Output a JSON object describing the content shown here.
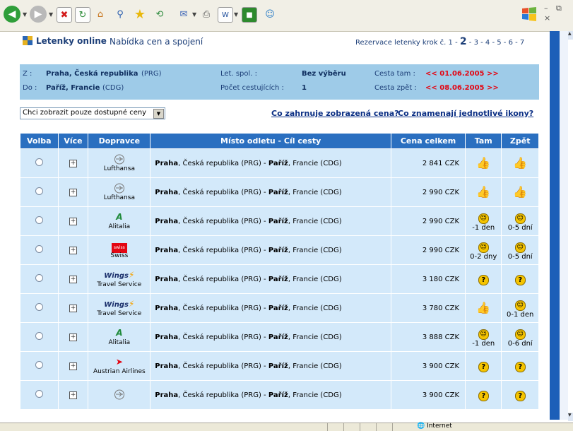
{
  "toolbar": {
    "buttons": [
      "back-icon",
      "forward-icon",
      "stop-icon",
      "refresh-icon",
      "home-icon",
      "search-icon",
      "favorites-icon",
      "history-icon",
      "mail-icon",
      "print-icon",
      "edit-icon",
      "messenger-icon",
      "contacts-icon"
    ],
    "window_controls": "– ⧉ ×"
  },
  "header": {
    "brand": "Letenky online",
    "subtitle": "Nabídka cen a spojení",
    "steps_prefix": "Rezervace letenky krok č. 1 - ",
    "current_step": "2",
    "steps_suffix": " - 3 - 4 - 5 - 6 - 7"
  },
  "info": {
    "from_label": "Z :",
    "from_value": "Praha, Česká republika",
    "from_code": "(PRG)",
    "to_label": "Do :",
    "to_value": "Paříž, Francie",
    "to_code": "(CDG)",
    "airline_label": "Let. spol. :",
    "airline_value": "Bez výběru",
    "passengers_label": "Počet cestujících :",
    "passengers_value": "1",
    "out_label": "Cesta tam :",
    "out_value": "<< 01.06.2005 >>",
    "back_label": "Cesta zpět :",
    "back_value": "<< 08.06.2005 >>"
  },
  "filter": {
    "select_value": "Chci zobrazit pouze dostupné ceny",
    "link_price": "Co zahrnuje zobrazená cena?",
    "link_icons": "Co znamenají jednotlivé ikony?"
  },
  "table": {
    "headers": [
      "Volba",
      "Více",
      "Dopravce",
      "Místo odletu - Cíl cesty",
      "Cena celkem",
      "Tam",
      "Zpět"
    ],
    "route_from": "Praha",
    "route_from_rest": ", Česká republika (PRG) - ",
    "route_to": "Paříž",
    "route_to_rest": ", Francie (CDG)",
    "rows": [
      {
        "carrier": "Lufthansa",
        "logo": "lufthansa-logo",
        "price": "2 841 CZK",
        "tam": "thumb",
        "tam_sub": "",
        "zpet": "thumb",
        "zpet_sub": ""
      },
      {
        "carrier": "Lufthansa",
        "logo": "lufthansa-logo",
        "price": "2 990 CZK",
        "tam": "thumb",
        "tam_sub": "",
        "zpet": "thumb",
        "zpet_sub": ""
      },
      {
        "carrier": "Alitalia",
        "logo": "alitalia-logo",
        "price": "2 990 CZK",
        "tam": "smile",
        "tam_sub": "-1 den",
        "zpet": "smile",
        "zpet_sub": "0-5 dní"
      },
      {
        "carrier": "Swiss",
        "logo": "swiss-logo",
        "price": "2 990 CZK",
        "tam": "smile",
        "tam_sub": "0-2 dny",
        "zpet": "smile",
        "zpet_sub": "0-5 dní"
      },
      {
        "carrier": "Travel Service",
        "logo": "smartwings-logo",
        "price": "3 180 CZK",
        "tam": "question",
        "tam_sub": "",
        "zpet": "question",
        "zpet_sub": ""
      },
      {
        "carrier": "Travel Service",
        "logo": "smartwings-logo",
        "price": "3 780 CZK",
        "tam": "thumb",
        "tam_sub": "",
        "zpet": "smile",
        "zpet_sub": "0-1 den"
      },
      {
        "carrier": "Alitalia",
        "logo": "alitalia-logo",
        "price": "3 888 CZK",
        "tam": "smile",
        "tam_sub": "-1 den",
        "zpet": "smile",
        "zpet_sub": "0-6 dní"
      },
      {
        "carrier": "Austrian Airlines",
        "logo": "austrian-logo",
        "price": "3 900 CZK",
        "tam": "question",
        "tam_sub": "",
        "zpet": "question",
        "zpet_sub": ""
      },
      {
        "carrier": "",
        "logo": "lufthansa-logo",
        "price": "3 900 CZK",
        "tam": "question",
        "tam_sub": "",
        "zpet": "question",
        "zpet_sub": ""
      }
    ]
  },
  "status": {
    "zone": "Internet"
  }
}
